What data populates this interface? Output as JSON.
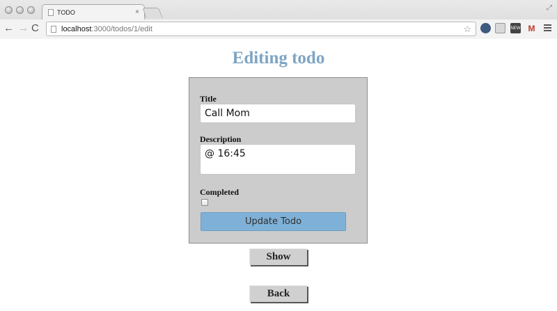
{
  "browser": {
    "tab_title": "TODO",
    "tab_close": "×",
    "url_host": "localhost",
    "url_path": ":3000/todos/1/edit",
    "nav_back": "←",
    "nav_forward": "→",
    "nav_reload": "C",
    "star": "☆",
    "resize": "⤢",
    "ext_badge": "NEW",
    "ext_mail": "M",
    "icons": [
      "back-arrow-icon",
      "forward-arrow-icon",
      "reload-icon",
      "bookmark-star-icon",
      "menu-icon"
    ]
  },
  "page": {
    "title": "Editing todo"
  },
  "form": {
    "title_label": "Title",
    "title_value": "Call Mom",
    "description_label": "Description",
    "description_value": "@ 16:45",
    "completed_label": "Completed",
    "completed_checked": false,
    "submit_label": "Update Todo"
  },
  "links": {
    "show_label": "Show",
    "back_label": "Back"
  },
  "colors": {
    "title": "#7ea4c4",
    "submit_bg": "#7fb1d8",
    "form_bg": "#cccccc",
    "link_bg": "#d0d0d0"
  }
}
